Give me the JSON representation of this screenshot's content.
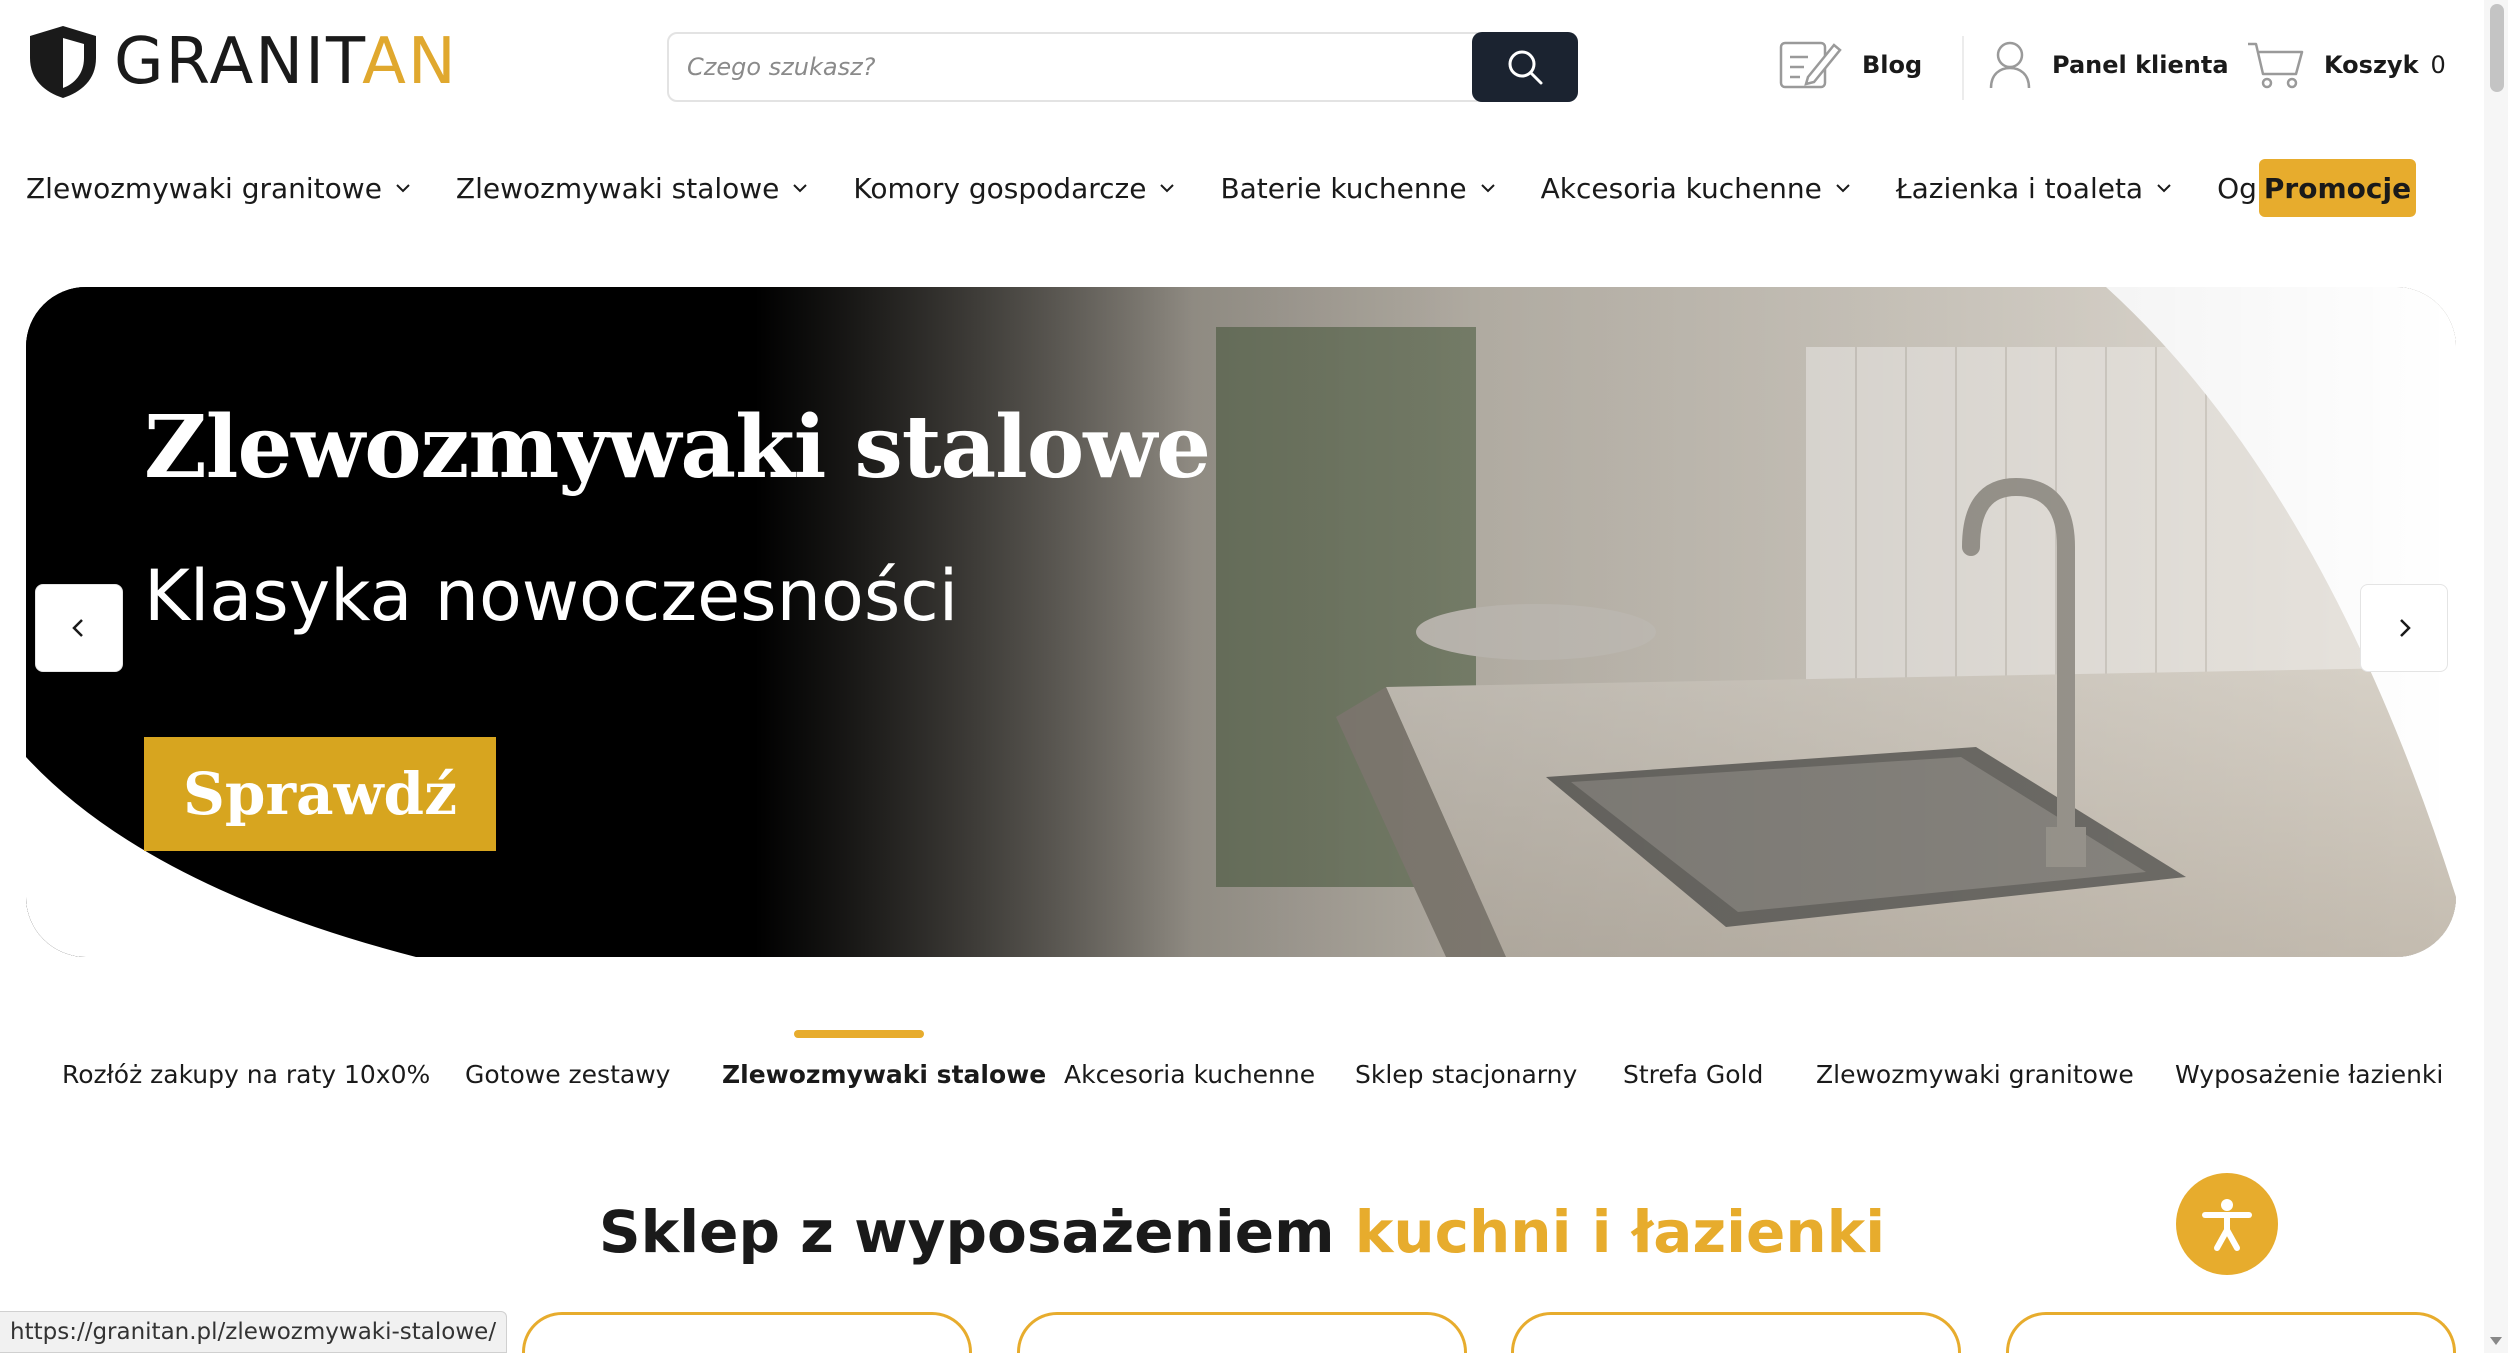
{
  "brand": {
    "name_part1": "GRANIT",
    "name_part2": "AN",
    "accent_color": "#e7ac2d"
  },
  "search": {
    "placeholder": "Czego szukasz?"
  },
  "header_links": {
    "blog": "Blog",
    "panel": "Panel klienta",
    "cart": "Koszyk",
    "cart_count": "0"
  },
  "nav": {
    "items": [
      {
        "label": "Zlewozmywaki granitowe"
      },
      {
        "label": "Zlewozmywaki stalowe"
      },
      {
        "label": "Komory gospodarcze"
      },
      {
        "label": "Baterie kuchenne"
      },
      {
        "label": "Akcesoria kuchenne"
      },
      {
        "label": "Łazienka i toaleta"
      },
      {
        "label": "Ogród"
      }
    ],
    "promo": "Promocje"
  },
  "hero": {
    "title": "Zlewozmywaki stalowe",
    "subtitle": "Klasyka nowoczesności",
    "cta": "Sprawdź"
  },
  "tabs": {
    "items": [
      {
        "label": "Rozłóż zakupy na raty 10x0%"
      },
      {
        "label": "Gotowe zestawy"
      },
      {
        "label": "Zlewozmywaki stalowe"
      },
      {
        "label": "Akcesoria kuchenne"
      },
      {
        "label": "Sklep stacjonarny"
      },
      {
        "label": "Strefa Gold"
      },
      {
        "label": "Zlewozmywaki granitowe"
      },
      {
        "label": "Wyposażenie łazienki"
      }
    ],
    "active_index": 2
  },
  "section": {
    "title_plain": "Sklep z wyposażeniem ",
    "title_accent": "kuchni i łazienki"
  },
  "status_url": "https://granitan.pl/zlewozmywaki-stalowe/",
  "icons": {
    "logo": "shield-logo-icon",
    "search": "search-icon",
    "blog": "blog-pencil-icon",
    "panel": "user-icon",
    "cart": "cart-icon",
    "chevron": "chevron-down-icon",
    "prev": "chevron-left-icon",
    "next": "chevron-right-icon",
    "accessibility": "accessibility-icon"
  }
}
